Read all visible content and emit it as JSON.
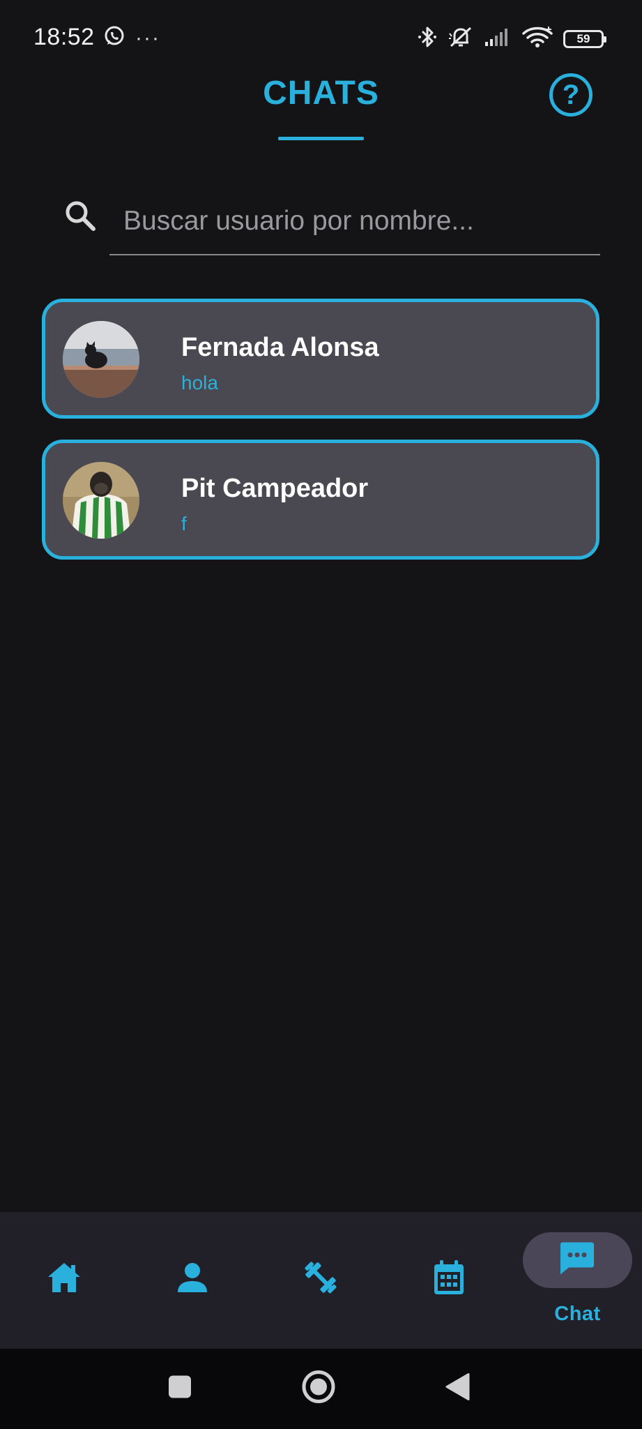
{
  "status_bar": {
    "time": "18:52",
    "dots": "···",
    "battery": "59",
    "icons": [
      "whatsapp-icon",
      "bluetooth-icon",
      "bell-off-icon",
      "signal-icon",
      "wifi-icon",
      "battery-icon"
    ]
  },
  "header": {
    "title": "CHATS",
    "help_icon": "help-icon",
    "help_glyph": "?"
  },
  "search": {
    "placeholder": "Buscar usuario por nombre...",
    "value": "",
    "icon": "search-icon"
  },
  "chats": [
    {
      "name": "Fernada Alonsa",
      "last_message": "hola"
    },
    {
      "name": "Pit Campeador",
      "last_message": "f"
    }
  ],
  "bottom_nav": {
    "items": [
      {
        "icon": "home-icon",
        "label": ""
      },
      {
        "icon": "person-icon",
        "label": ""
      },
      {
        "icon": "dumbbell-icon",
        "label": ""
      },
      {
        "icon": "calendar-icon",
        "label": ""
      },
      {
        "icon": "chat-icon",
        "label": "Chat"
      }
    ],
    "active_index": 4
  },
  "colors": {
    "accent": "#2ab0dc",
    "background": "#141416",
    "card": "#4a4850",
    "nav_bar": "#211f27",
    "active_pill": "#4a4658"
  }
}
